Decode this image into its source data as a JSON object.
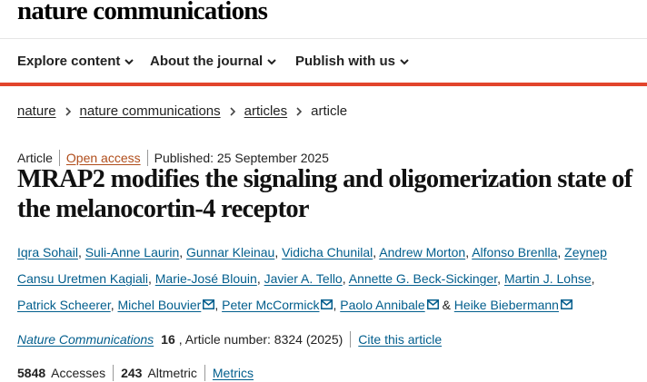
{
  "site": {
    "logo": "nature communications"
  },
  "nav": {
    "items": [
      {
        "label": "Explore content"
      },
      {
        "label": "About the journal"
      },
      {
        "label": "Publish with us"
      }
    ]
  },
  "breadcrumb": [
    "nature",
    "nature communications",
    "articles",
    "article"
  ],
  "meta": {
    "type": "Article",
    "access": "Open access",
    "published": "Published: 25 September 2025"
  },
  "title": "MRAP2 modifies the signaling and oligomerization state of the melanocortin-4 receptor",
  "authors": [
    {
      "name": "Iqra Sohail",
      "email": false
    },
    {
      "name": "Suli-Anne Laurin",
      "email": false
    },
    {
      "name": "Gunnar Kleinau",
      "email": false
    },
    {
      "name": "Vidicha Chunilal",
      "email": false
    },
    {
      "name": "Andrew Morton",
      "email": false
    },
    {
      "name": "Alfonso Brenlla",
      "email": false
    },
    {
      "name": "Zeynep Cansu Uretmen Kagiali",
      "email": false
    },
    {
      "name": "Marie-José Blouin",
      "email": false
    },
    {
      "name": "Javier A. Tello",
      "email": false
    },
    {
      "name": "Annette G. Beck-Sickinger",
      "email": false
    },
    {
      "name": "Martin J. Lohse",
      "email": false
    },
    {
      "name": "Patrick Scheerer",
      "email": false
    },
    {
      "name": "Michel Bouvier",
      "email": true
    },
    {
      "name": "Peter McCormick",
      "email": true
    },
    {
      "name": "Paolo Annibale",
      "email": true
    },
    {
      "name": "Heike Biebermann",
      "email": true
    }
  ],
  "authors_final_conjunction": "&",
  "citation": {
    "journal": "Nature Communications",
    "volume": "16",
    "article_number": ", Article number: 8324 (2025)",
    "cite_link": "Cite this article"
  },
  "metrics": {
    "accesses_value": "5848",
    "accesses_label": "Accesses",
    "altmetric_value": "243",
    "altmetric_label": "Altmetric",
    "metrics_link": "Metrics"
  },
  "colors": {
    "accent": "#e2442c",
    "link": "#025e8d",
    "open_access": "#b04d1b"
  }
}
